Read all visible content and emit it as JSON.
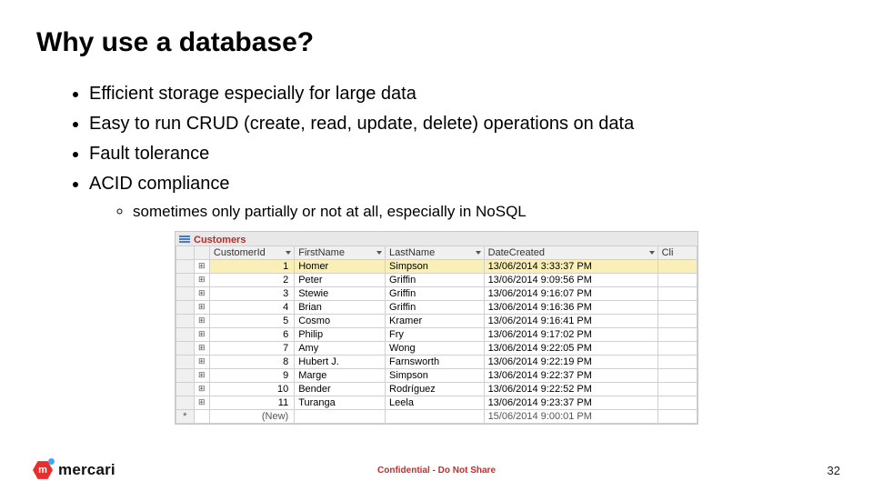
{
  "title": "Why use a database?",
  "bullets": {
    "b1": "Efficient storage especially for large data",
    "b2": "Easy to run CRUD (create, read, update, delete) operations on data",
    "b3": "Fault tolerance",
    "b4": "ACID compliance",
    "b4a": "sometimes only partially or not at all, especially in NoSQL"
  },
  "table": {
    "tab": "Customers",
    "headers": {
      "id": "CustomerId",
      "fn": "FirstName",
      "ln": "LastName",
      "dc": "DateCreated",
      "cli": "Cli"
    },
    "rows": [
      {
        "id": "1",
        "fn": "Homer",
        "ln": "Simpson",
        "dc": "13/06/2014 3:33:37 PM"
      },
      {
        "id": "2",
        "fn": "Peter",
        "ln": "Griffin",
        "dc": "13/06/2014 9:09:56 PM"
      },
      {
        "id": "3",
        "fn": "Stewie",
        "ln": "Griffin",
        "dc": "13/06/2014 9:16:07 PM"
      },
      {
        "id": "4",
        "fn": "Brian",
        "ln": "Griffin",
        "dc": "13/06/2014 9:16:36 PM"
      },
      {
        "id": "5",
        "fn": "Cosmo",
        "ln": "Kramer",
        "dc": "13/06/2014 9:16:41 PM"
      },
      {
        "id": "6",
        "fn": "Philip",
        "ln": "Fry",
        "dc": "13/06/2014 9:17:02 PM"
      },
      {
        "id": "7",
        "fn": "Amy",
        "ln": "Wong",
        "dc": "13/06/2014 9:22:05 PM"
      },
      {
        "id": "8",
        "fn": "Hubert J.",
        "ln": "Farnsworth",
        "dc": "13/06/2014 9:22:19 PM"
      },
      {
        "id": "9",
        "fn": "Marge",
        "ln": "Simpson",
        "dc": "13/06/2014 9:22:37 PM"
      },
      {
        "id": "10",
        "fn": "Bender",
        "ln": "Rodríguez",
        "dc": "13/06/2014 9:22:52 PM"
      },
      {
        "id": "11",
        "fn": "Turanga",
        "ln": "Leela",
        "dc": "13/06/2014 9:23:37 PM"
      }
    ],
    "newrow": {
      "label": "(New)",
      "dc": "15/06/2014 9:00:01 PM",
      "star": "*"
    },
    "plus": "⊞"
  },
  "footer": {
    "brand_letter": "m",
    "brand": "mercari",
    "confidential": "Confidential - Do Not Share",
    "page": "32"
  }
}
